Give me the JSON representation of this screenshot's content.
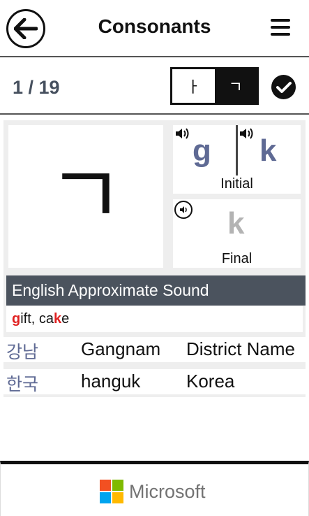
{
  "header": {
    "title": "Consonants",
    "back_icon": "arrow-left-icon",
    "menu_icon": "hamburger-menu-icon"
  },
  "toolbar": {
    "counter": "1 / 19",
    "toggle_vowel": "ㅏ",
    "toggle_consonant": "ㄱ",
    "toggle_selected": "ㄱ",
    "check_icon": "checkmark-icon"
  },
  "letter_card": {
    "character": "ㄱ",
    "initial": {
      "sound_1": "g",
      "sound_2": "k",
      "label": "Initial"
    },
    "final": {
      "sound": "k",
      "label": "Final"
    }
  },
  "approx": {
    "heading": "English Approximate Sound",
    "ex1_hl": "g",
    "ex1_rest": "ift, ca",
    "ex2_hl": "k",
    "ex2_rest": "e"
  },
  "words": [
    {
      "korean": "강남",
      "romanized": "Gangnam",
      "meaning": "District Name"
    },
    {
      "korean": "한국",
      "romanized": "hanguk",
      "meaning": "Korea"
    }
  ],
  "footer": {
    "brand": "Microsoft",
    "logo_colors": [
      "#f25022",
      "#7fba00",
      "#00a4ef",
      "#ffb900"
    ]
  },
  "colors": {
    "accent_blue": "#5f6a94",
    "highlight_red": "#e02020",
    "bar_dark": "#4b535e"
  }
}
